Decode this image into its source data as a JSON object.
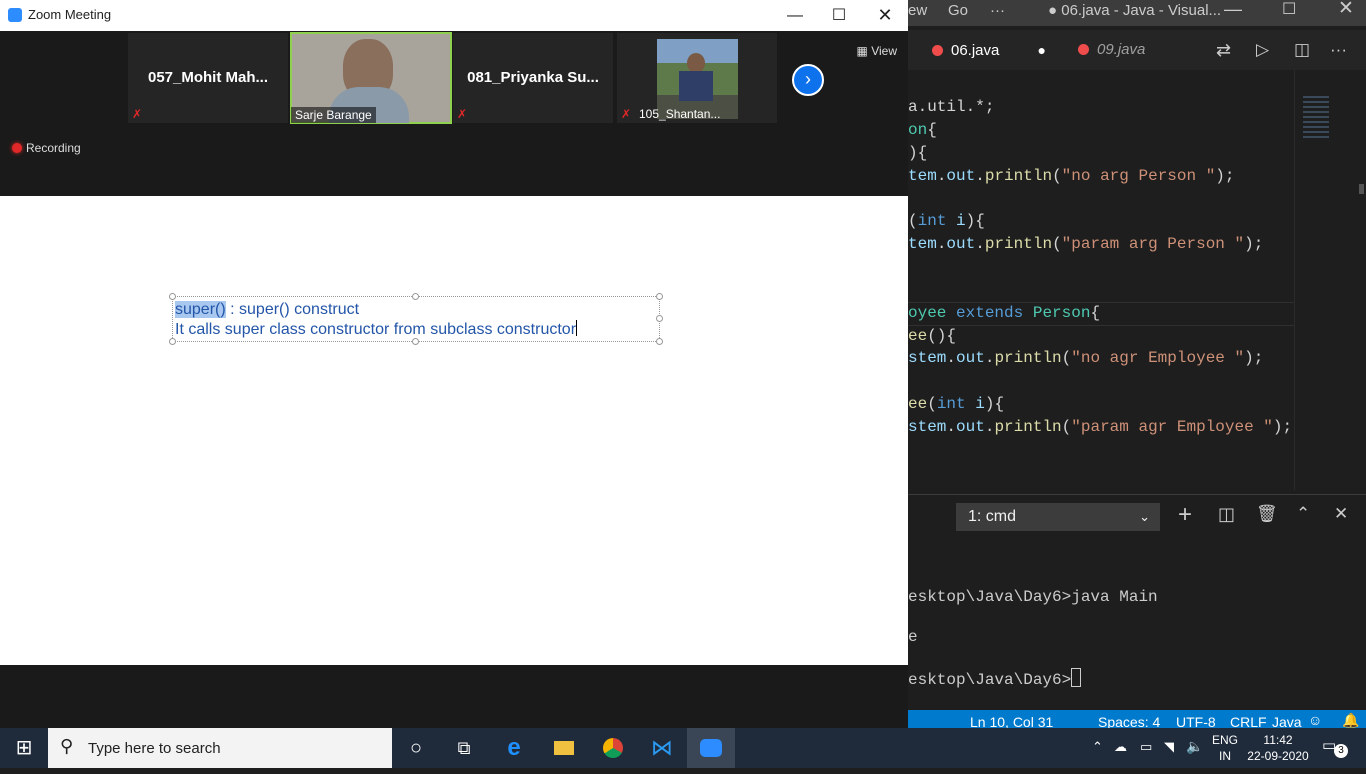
{
  "zoom": {
    "window_title": "Zoom Meeting",
    "view_label": "View",
    "recording_label": "Recording",
    "participants": [
      {
        "name": "057_Mohit  Mah..."
      },
      {
        "name": "Sarje Barange"
      },
      {
        "name": "081_Priyanka  Su..."
      },
      {
        "name": "105_Shantan..."
      }
    ],
    "whiteboard": {
      "line1_highlight": "super()",
      "line1_rest": " : super() construct",
      "line2": "It calls super class constructor from subclass constructor"
    },
    "colors": {
      "accent": "#0e72ed",
      "highlight": "#a8c8f0",
      "text_blue": "#2355a8"
    }
  },
  "vscode": {
    "menu_view": "ew",
    "menu_go": "Go",
    "menu_more": "···",
    "title": "● 06.java - Java - Visual...",
    "tabs": [
      {
        "label": "06.java"
      },
      {
        "label": "09.java"
      }
    ],
    "terminal_select": "1: cmd",
    "terminal_lines": [
      "esktop\\Java\\Day6>java Main",
      "e",
      "esktop\\Java\\Day6>"
    ],
    "status": {
      "position": "Ln 10, Col 31",
      "spaces": "Spaces: 4",
      "encoding": "UTF-8",
      "eol": "CRLF",
      "language": "Java"
    }
  },
  "taskbar": {
    "search_placeholder": "Type here to search",
    "lang_top": "ENG",
    "lang_bottom": "IN",
    "time": "11:42",
    "date": "22-09-2020",
    "notifications": "3"
  }
}
